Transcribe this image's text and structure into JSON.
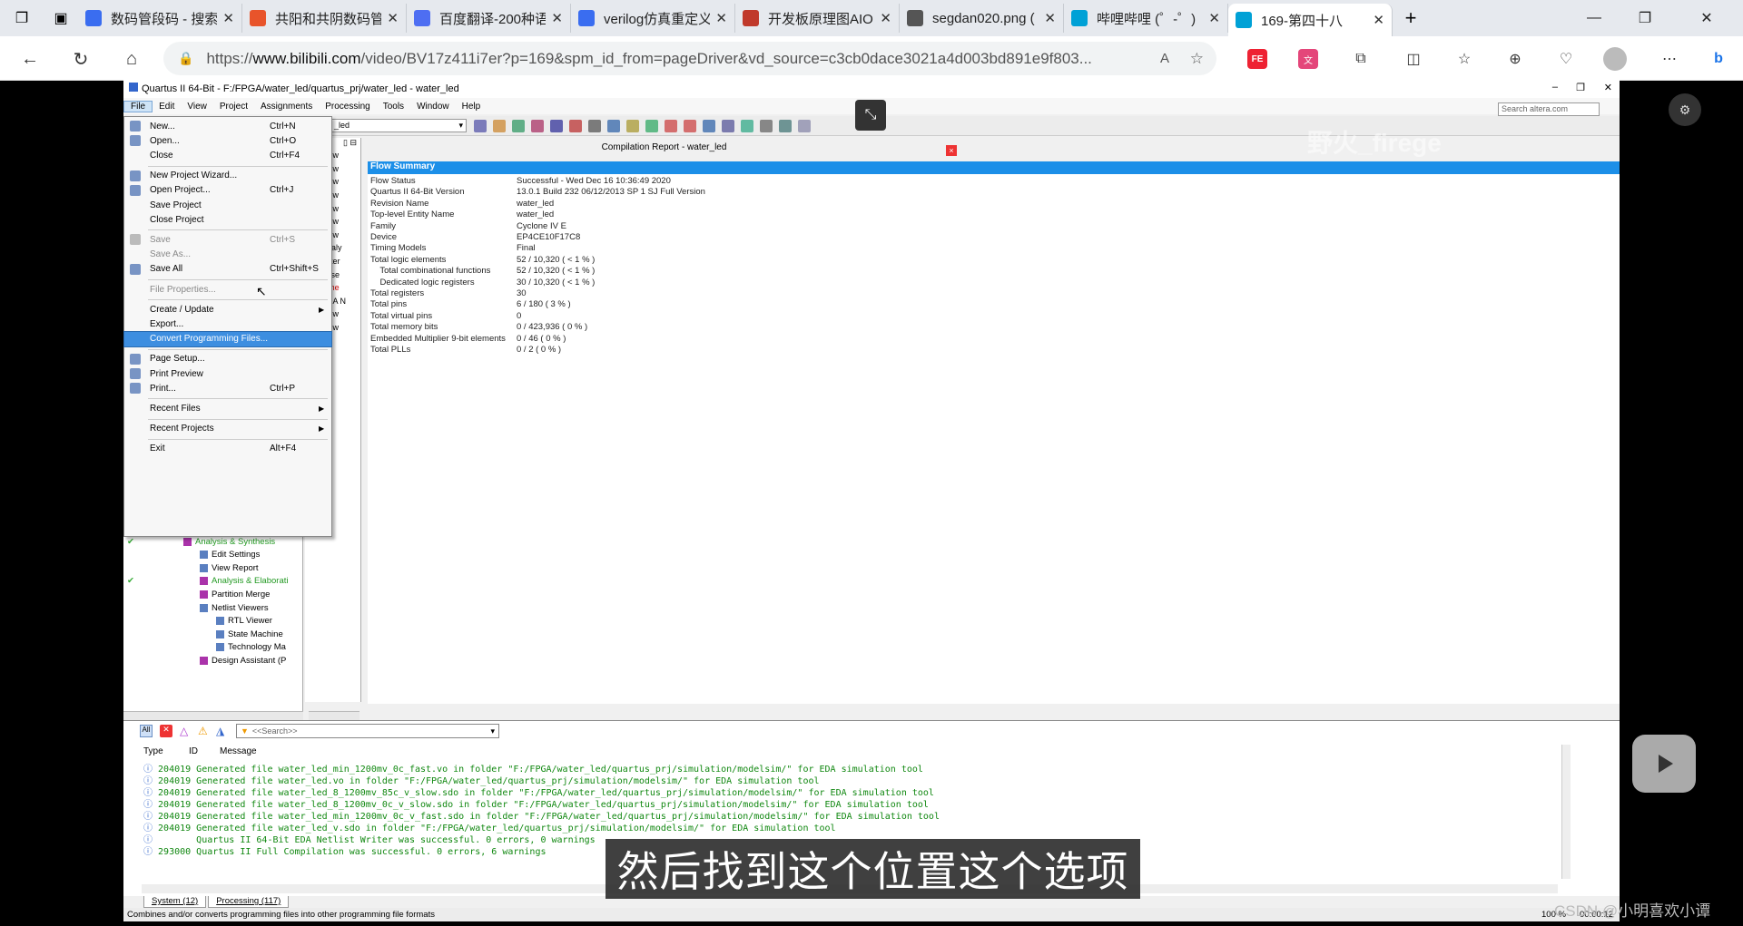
{
  "browser": {
    "tabs": [
      {
        "title": "数码管段码 - 搜索",
        "icon": "search-icon",
        "color": "#3a6df0"
      },
      {
        "title": "共阳和共阴数码管",
        "icon": "csdn-icon",
        "color": "#e8542b"
      },
      {
        "title": "百度翻译-200种语",
        "icon": "translate-icon",
        "color": "#4e6ef2"
      },
      {
        "title": "verilog仿真重定义",
        "icon": "search-icon",
        "color": "#3a6df0"
      },
      {
        "title": "开发板原理图AIO",
        "icon": "pdf-icon",
        "color": "#c0392b"
      },
      {
        "title": "segdan020.png (",
        "icon": "file-icon",
        "color": "#555"
      },
      {
        "title": "哔哩哔哩 (゜-゜)",
        "icon": "bilibili-icon",
        "color": "#00a1d6"
      },
      {
        "title": "169-第四十八",
        "icon": "bilibili-icon",
        "color": "#00a1d6"
      }
    ],
    "url_prefix": "https://",
    "url_host": "www.bilibili.com",
    "url_rest": "/video/BV17z411i7er?p=169&spm_id_from=pageDriver&vd_source=c3cb0dace3021a4d003bd891e9f803..."
  },
  "quartus": {
    "title": "Quartus II 64-Bit - F:/FPGA/water_led/quartus_prj/water_led - water_led",
    "menubar": [
      "File",
      "Edit",
      "View",
      "Project",
      "Assignments",
      "Processing",
      "Tools",
      "Window",
      "Help"
    ],
    "search_placeholder": "Search altera.com",
    "entity_combo": "_led",
    "report_title": "Compilation Report - water_led",
    "flow_summary_label": "Flow Summary",
    "summary_rows": [
      {
        "k": "Flow Status",
        "v": "Successful - Wed Dec 16 10:36:49 2020"
      },
      {
        "k": "Quartus II 64-Bit Version",
        "v": "13.0.1 Build 232 06/12/2013 SP 1 SJ Full Version"
      },
      {
        "k": "Revision Name",
        "v": "water_led"
      },
      {
        "k": "Top-level Entity Name",
        "v": "water_led"
      },
      {
        "k": "Family",
        "v": "Cyclone IV E"
      },
      {
        "k": "Device",
        "v": "EP4CE10F17C8"
      },
      {
        "k": "Timing Models",
        "v": "Final"
      },
      {
        "k": "Total logic elements",
        "v": "52 / 10,320 ( < 1 % )"
      },
      {
        "k": "    Total combinational functions",
        "v": "52 / 10,320 ( < 1 % )"
      },
      {
        "k": "    Dedicated logic registers",
        "v": "30 / 10,320 ( < 1 % )"
      },
      {
        "k": "Total registers",
        "v": "30"
      },
      {
        "k": "Total pins",
        "v": "6 / 180 ( 3 % )"
      },
      {
        "k": "Total virtual pins",
        "v": "0"
      },
      {
        "k": "Total memory bits",
        "v": "0 / 423,936 ( 0 % )"
      },
      {
        "k": "Embedded Multiplier 9-bit elements",
        "v": "0 / 46 ( 0 % )"
      },
      {
        "k": "Total PLLs",
        "v": "0 / 2 ( 0 % )"
      }
    ],
    "mid_items": [
      "Flow",
      "Flow",
      "Flow",
      "Flow",
      "Flow",
      "Flow",
      "Flow",
      "Analy",
      "Fitter",
      "Asse",
      "Time",
      "EDA N",
      "Flow",
      "Flow"
    ],
    "file_menu": [
      {
        "label": "New...",
        "shortcut": "Ctrl+N",
        "icon": "new-file-icon"
      },
      {
        "label": "Open...",
        "shortcut": "Ctrl+O",
        "icon": "folder-open-icon"
      },
      {
        "label": "Close",
        "shortcut": "Ctrl+F4",
        "icon": ""
      },
      {
        "sep": true
      },
      {
        "label": "New Project Wizard...",
        "shortcut": "",
        "icon": "wizard-icon"
      },
      {
        "label": "Open Project...",
        "shortcut": "Ctrl+J",
        "icon": "folder-open-icon"
      },
      {
        "label": "Save Project",
        "shortcut": "",
        "icon": ""
      },
      {
        "label": "Close Project",
        "shortcut": "",
        "icon": ""
      },
      {
        "sep": true
      },
      {
        "label": "Save",
        "shortcut": "Ctrl+S",
        "icon": "save-icon",
        "disabled": true
      },
      {
        "label": "Save As...",
        "shortcut": "",
        "icon": "",
        "disabled": true
      },
      {
        "label": "Save All",
        "shortcut": "Ctrl+Shift+S",
        "icon": "save-all-icon"
      },
      {
        "sep": true
      },
      {
        "label": "File Properties...",
        "shortcut": "",
        "icon": "",
        "disabled": true
      },
      {
        "sep": true
      },
      {
        "label": "Create / Update",
        "shortcut": "",
        "icon": "",
        "submenu": true
      },
      {
        "label": "Export...",
        "shortcut": "",
        "icon": ""
      },
      {
        "label": "Convert Programming Files...",
        "shortcut": "",
        "icon": "",
        "highlight": true
      },
      {
        "sep": true
      },
      {
        "label": "Page Setup...",
        "shortcut": "",
        "icon": "page-setup-icon"
      },
      {
        "label": "Print Preview",
        "shortcut": "",
        "icon": "print-preview-icon"
      },
      {
        "label": "Print...",
        "shortcut": "Ctrl+P",
        "icon": "print-icon"
      },
      {
        "sep": true
      },
      {
        "label": "Recent Files",
        "shortcut": "",
        "icon": "",
        "submenu": true
      },
      {
        "sep": true
      },
      {
        "label": "Recent Projects",
        "shortcut": "",
        "icon": "",
        "submenu": true
      },
      {
        "sep": true
      },
      {
        "label": "Exit",
        "shortcut": "Alt+F4",
        "icon": ""
      }
    ],
    "tasks": [
      {
        "label": "Analysis & Synthesis",
        "indent": 1,
        "check": true,
        "green": true
      },
      {
        "label": "Edit Settings",
        "indent": 2
      },
      {
        "label": "View Report",
        "indent": 2
      },
      {
        "label": "Analysis & Elaborati",
        "indent": 2,
        "check": true,
        "green": true
      },
      {
        "label": "Partition Merge",
        "indent": 2
      },
      {
        "label": "Netlist Viewers",
        "indent": 2
      },
      {
        "label": "RTL Viewer",
        "indent": 3
      },
      {
        "label": "State Machine",
        "indent": 3
      },
      {
        "label": "Technology Ma",
        "indent": 3
      },
      {
        "label": "Design Assistant (P",
        "indent": 2
      }
    ],
    "msg_search": "<<Search>>",
    "msg_headers": [
      "Type",
      "ID",
      "Message"
    ],
    "messages": [
      "204019 Generated file water_led_min_1200mv_0c_fast.vo in folder \"F:/FPGA/water_led/quartus_prj/simulation/modelsim/\" for EDA simulation tool",
      "204019 Generated file water_led.vo in folder \"F:/FPGA/water_led/quartus_prj/simulation/modelsim/\" for EDA simulation tool",
      "204019 Generated file water_led_8_1200mv_85c_v_slow.sdo in folder \"F:/FPGA/water_led/quartus_prj/simulation/modelsim/\" for EDA simulation tool",
      "204019 Generated file water_led_8_1200mv_0c_v_slow.sdo in folder \"F:/FPGA/water_led/quartus_prj/simulation/modelsim/\" for EDA simulation tool",
      "204019 Generated file water_led_min_1200mv_0c_v_fast.sdo in folder \"F:/FPGA/water_led/quartus_prj/simulation/modelsim/\" for EDA simulation tool",
      "204019 Generated file water_led_v.sdo in folder \"F:/FPGA/water_led/quartus_prj/simulation/modelsim/\" for EDA simulation tool",
      "       Quartus II 64-Bit EDA Netlist Writer was successful. 0 errors, 0 warnings",
      "293000 Quartus II Full Compilation was successful. 0 errors, 6 warnings"
    ],
    "msg_tabs": [
      "System (12)",
      "Processing (117)"
    ],
    "status_text": "Combines and/or converts programming files into other programming file formats",
    "zoom": "100 %",
    "time": "00:00:12"
  },
  "video": {
    "subtitle": "然后找到这个位置这个选项",
    "watermark": "野火_firege",
    "credit": "CSDN @小明喜欢小谭"
  }
}
